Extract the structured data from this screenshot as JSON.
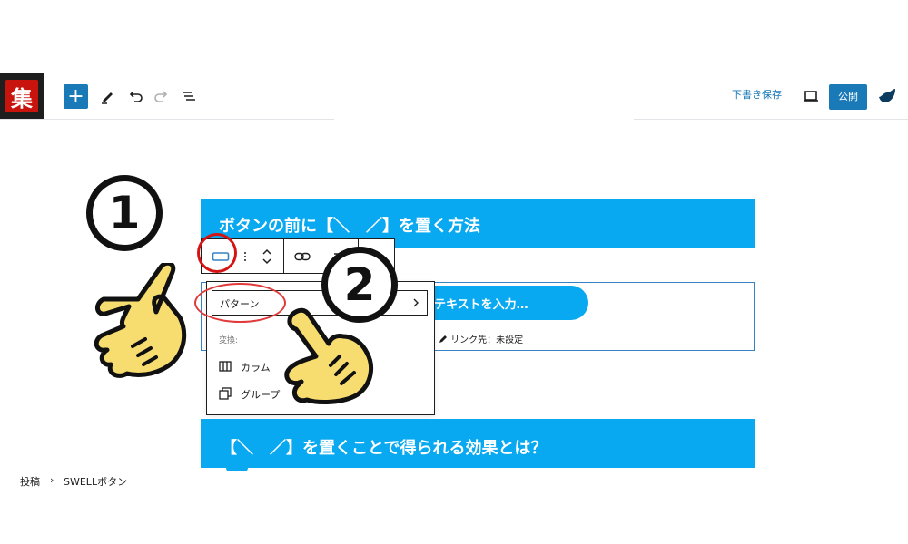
{
  "app": {
    "logo_text": "集"
  },
  "toolbar": {
    "add_label": "+",
    "icons": [
      "plus-icon",
      "pencil-icon",
      "undo-icon",
      "redo-icon",
      "list-view-icon",
      "desktop-preview-icon",
      "swell-logo-icon"
    ],
    "save_draft_label": "下書き保存",
    "publish_label": "公開"
  },
  "content": {
    "heading1": "ボタンの前に【＼　／】を置く方法",
    "button_placeholder": "テキストを入力…",
    "link_note": "リンク先：未設定",
    "heading2": "【＼　／】を置くことで得られる効果とは？"
  },
  "block_toolbar": {
    "icons": [
      "button-block-icon",
      "move-arrows-icon",
      "link-icon",
      "align-icon",
      "more-options-icon"
    ]
  },
  "dropdown": {
    "pattern_label": "パターン",
    "section_label": "変換:",
    "items": [
      {
        "label": "カラム",
        "icon": "columns-icon"
      },
      {
        "label": "グループ",
        "icon": "group-icon"
      }
    ]
  },
  "breadcrumb": {
    "items": [
      "投稿",
      "SWELLボタン"
    ],
    "separator": "›"
  },
  "annotations": {
    "step1": "1",
    "step2": "2",
    "highlight_color": "#d41414",
    "hand_color": "#f7dc6f"
  },
  "colors": {
    "accent": "#1a7ab8",
    "block_blue": "#08a9f0"
  }
}
